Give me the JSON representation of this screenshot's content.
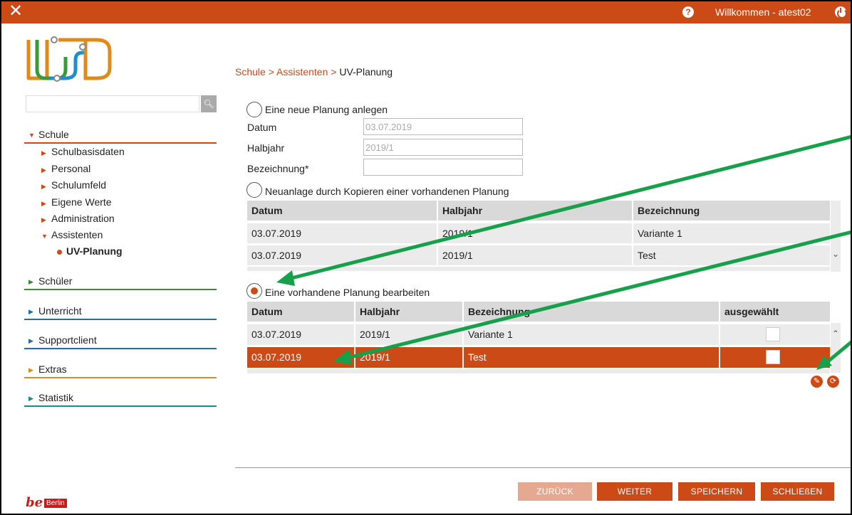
{
  "topbar": {
    "welcome": "Willkommen - atest02"
  },
  "search": {
    "placeholder": ""
  },
  "nav": {
    "schule": "Schule",
    "sub": [
      "Schulbasisdaten",
      "Personal",
      "Schulumfeld",
      "Eigene Werte",
      "Administration",
      "Assistenten"
    ],
    "active": "UV-Planung",
    "schueler": "Schüler",
    "unterricht": "Unterricht",
    "supportclient": "Supportclient",
    "extras": "Extras",
    "statistik": "Statistik"
  },
  "brand": {
    "be": "be",
    "berlin": "Berlin"
  },
  "breadcrumb": {
    "part1": "Schule > Assistenten > ",
    "current": "UV-Planung"
  },
  "new_plan": {
    "label": "Eine neue Planung anlegen",
    "datum_label": "Datum",
    "datum_value": "03.07.2019",
    "halbjahr_label": "Halbjahr",
    "halbjahr_value": "2019/1",
    "bez_label": "Bezeichnung*",
    "bez_value": ""
  },
  "copy_plan": {
    "label": "Neuanlage durch Kopieren einer vorhandenen Planung",
    "headers": [
      "Datum",
      "Halbjahr",
      "Bezeichnung"
    ],
    "rows": [
      [
        "03.07.2019",
        "2019/1",
        "Variante 1"
      ],
      [
        "03.07.2019",
        "2019/1",
        "Test"
      ]
    ]
  },
  "edit_plan": {
    "label": "Eine vorhandene Planung bearbeiten",
    "headers": [
      "Datum",
      "Halbjahr",
      "Bezeichnung",
      "ausgewählt"
    ],
    "rows": [
      [
        "03.07.2019",
        "2019/1",
        "Variante 1"
      ],
      [
        "03.07.2019",
        "2019/1",
        "Test"
      ]
    ]
  },
  "buttons": {
    "back": "ZURÜCK",
    "next": "WEITER",
    "save": "SPEICHERN",
    "close": "SCHLIEßEN"
  },
  "colors": {
    "accent": "#cc4a16",
    "annotation_arrow": "#16a04a"
  }
}
